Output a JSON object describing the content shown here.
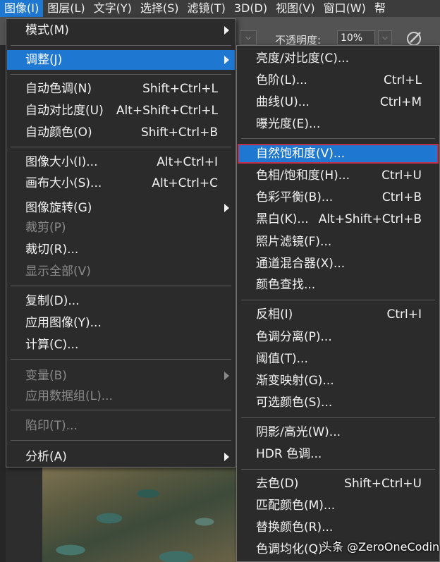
{
  "menubar": {
    "items": [
      "图像(I)",
      "图层(L)",
      "文字(Y)",
      "选择(S)",
      "滤镜(T)",
      "3D(D)",
      "视图(V)",
      "窗口(W)",
      "帮"
    ]
  },
  "options": {
    "opacity_label": "不透明度:",
    "opacity_value": "10%"
  },
  "image_menu": {
    "items": [
      {
        "label": "模式(M)",
        "shortcut": "",
        "submenu": true
      },
      {
        "label": "调整(J)",
        "shortcut": "",
        "submenu": true
      },
      {
        "label": "自动色调(N)",
        "shortcut": "Shift+Ctrl+L"
      },
      {
        "label": "自动对比度(U)",
        "shortcut": "Alt+Shift+Ctrl+L"
      },
      {
        "label": "自动颜色(O)",
        "shortcut": "Shift+Ctrl+B"
      },
      {
        "label": "图像大小(I)...",
        "shortcut": "Alt+Ctrl+I"
      },
      {
        "label": "画布大小(S)...",
        "shortcut": "Alt+Ctrl+C"
      },
      {
        "label": "图像旋转(G)",
        "shortcut": "",
        "submenu": true
      },
      {
        "label": "裁剪(P)",
        "shortcut": "",
        "disabled": true
      },
      {
        "label": "裁切(R)...",
        "shortcut": ""
      },
      {
        "label": "显示全部(V)",
        "shortcut": "",
        "disabled": true
      },
      {
        "label": "复制(D)...",
        "shortcut": ""
      },
      {
        "label": "应用图像(Y)...",
        "shortcut": ""
      },
      {
        "label": "计算(C)...",
        "shortcut": ""
      },
      {
        "label": "变量(B)",
        "shortcut": "",
        "submenu": true,
        "disabled": true
      },
      {
        "label": "应用数据组(L)...",
        "shortcut": "",
        "disabled": true
      },
      {
        "label": "陷印(T)...",
        "shortcut": "",
        "disabled": true
      },
      {
        "label": "分析(A)",
        "shortcut": "",
        "submenu": true
      }
    ]
  },
  "adjust_menu": {
    "items": [
      {
        "label": "亮度/对比度(C)...",
        "shortcut": ""
      },
      {
        "label": "色阶(L)...",
        "shortcut": "Ctrl+L"
      },
      {
        "label": "曲线(U)...",
        "shortcut": "Ctrl+M"
      },
      {
        "label": "曝光度(E)...",
        "shortcut": ""
      },
      {
        "label": "自然饱和度(V)...",
        "shortcut": ""
      },
      {
        "label": "色相/饱和度(H)...",
        "shortcut": "Ctrl+U"
      },
      {
        "label": "色彩平衡(B)...",
        "shortcut": "Ctrl+B"
      },
      {
        "label": "黑白(K)...",
        "shortcut": "Alt+Shift+Ctrl+B"
      },
      {
        "label": "照片滤镜(F)...",
        "shortcut": ""
      },
      {
        "label": "通道混合器(X)...",
        "shortcut": ""
      },
      {
        "label": "颜色查找...",
        "shortcut": ""
      },
      {
        "label": "反相(I)",
        "shortcut": "Ctrl+I"
      },
      {
        "label": "色调分离(P)...",
        "shortcut": ""
      },
      {
        "label": "阈值(T)...",
        "shortcut": ""
      },
      {
        "label": "渐变映射(G)...",
        "shortcut": ""
      },
      {
        "label": "可选颜色(S)...",
        "shortcut": ""
      },
      {
        "label": "阴影/高光(W)...",
        "shortcut": ""
      },
      {
        "label": "HDR 色调...",
        "shortcut": ""
      },
      {
        "label": "去色(D)",
        "shortcut": "Shift+Ctrl+U"
      },
      {
        "label": "匹配颜色(M)...",
        "shortcut": ""
      },
      {
        "label": "替换颜色(R)...",
        "shortcut": ""
      },
      {
        "label": "色调均化(Q)",
        "shortcut": ""
      }
    ]
  },
  "watermark": "头条 @ZeroOneCoding",
  "colors": {
    "highlight": "#1e78d2",
    "outline": "#c0304a",
    "menu_bg": "#2b2b2b"
  }
}
